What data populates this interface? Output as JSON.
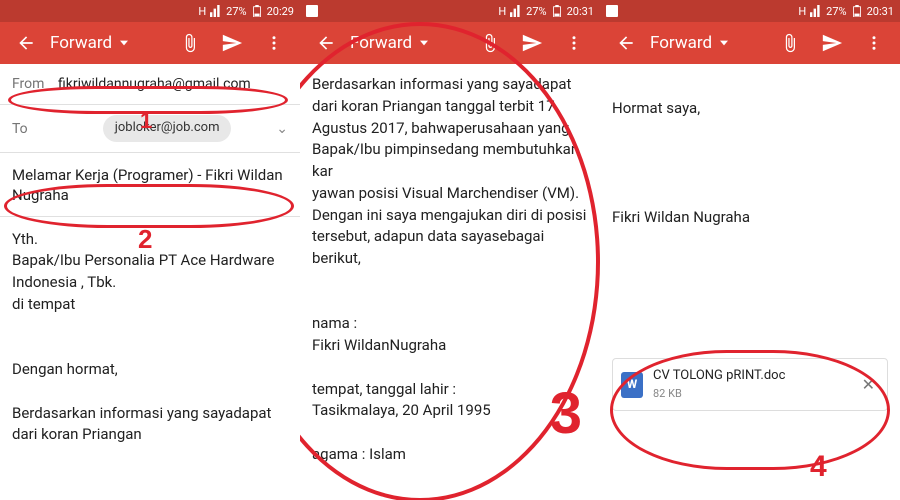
{
  "status": {
    "battery": "27%",
    "time1": "20:29",
    "time2": "20:31",
    "time3": "20:31"
  },
  "appbar": {
    "title": "Forward"
  },
  "compose": {
    "from_label": "From",
    "from_value": "fikriwildannugraha@gmail.com",
    "to_label": "To",
    "to_value": "jobloker@job.com",
    "subject": "Melamar Kerja (Programer) - Fikri Wildan Nugraha"
  },
  "screen1_body": "Yth.\nBapak/Ibu Personalia PT Ace Hardware Indonesia , Tbk.\ndi tempat\n\n\nDengan hormat,\n\nBerdasarkan informasi yang sayadapat dari koran Priangan",
  "screen2_body": "Berdasarkan informasi yang sayadapat dari koran Priangan tanggal terbit 17 Agustus 2017, bahwaperusahaan yang Bapak/Ibu pimpinsedang membutuhkan kar\nyawan posisi Visual Marchendiser (VM).\nDengan ini saya mengajukan diri di posisi tersebut, adapun data sayasebagai berikut,\n\n\nnama                                :\nFikri WildanNugraha\n\ntempat, tanggal lahir        :\nTasikmalaya, 20  April 1995\n\nagama                              : Islam",
  "screen3_body": "\nHormat saya,\n\n\n\n\nFikri Wildan Nugraha",
  "attachment": {
    "name": "CV TOLONG pRINT.doc",
    "size": "82 KB",
    "type": "W"
  },
  "anno": {
    "n1": "1",
    "n2": "2",
    "n3": "3",
    "n4": "4"
  }
}
